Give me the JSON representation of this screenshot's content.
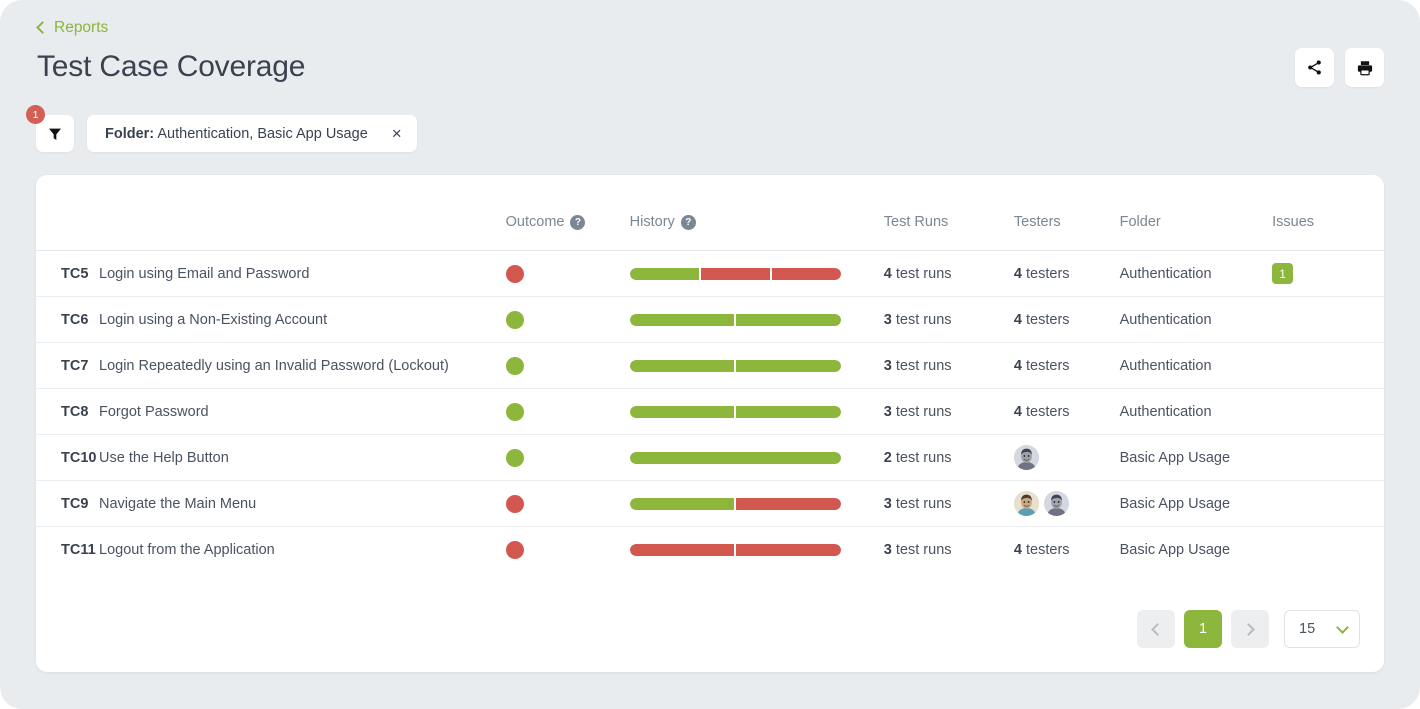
{
  "header": {
    "breadcrumb_label": "Reports",
    "title": "Test Case Coverage",
    "share_icon": "share-icon",
    "print_icon": "print-icon"
  },
  "filters": {
    "badge_count": "1",
    "filter_icon": "funnel-icon",
    "chip_prefix": "Folder:",
    "chip_value": " Authentication, Basic App Usage",
    "chip_close": "×"
  },
  "table": {
    "columns": [
      {
        "key": "id",
        "label": ""
      },
      {
        "key": "name",
        "label": ""
      },
      {
        "key": "outcome",
        "label": "Outcome",
        "help": true
      },
      {
        "key": "history",
        "label": "History",
        "help": true
      },
      {
        "key": "testruns",
        "label": "Test Runs"
      },
      {
        "key": "testers",
        "label": "Testers"
      },
      {
        "key": "folder",
        "label": "Folder"
      },
      {
        "key": "issues",
        "label": "Issues"
      }
    ],
    "rows": [
      {
        "id": "TC5",
        "name": "Login using Email and Password",
        "outcome": "fail",
        "history": [
          "pass",
          "fail",
          "fail"
        ],
        "test_runs_count": "4",
        "test_runs_label": " test runs",
        "testers_count": "4",
        "testers_label": " testers",
        "testers_avatars": 0,
        "folder": "Authentication",
        "issues": "1"
      },
      {
        "id": "TC6",
        "name": "Login using a Non-Existing Account",
        "outcome": "pass",
        "history": [
          "pass",
          "pass"
        ],
        "test_runs_count": "3",
        "test_runs_label": " test runs",
        "testers_count": "4",
        "testers_label": " testers",
        "testers_avatars": 0,
        "folder": "Authentication",
        "issues": ""
      },
      {
        "id": "TC7",
        "name": "Login Repeatedly using an Invalid Password (Lockout)",
        "outcome": "pass",
        "history": [
          "pass",
          "pass"
        ],
        "test_runs_count": "3",
        "test_runs_label": " test runs",
        "testers_count": "4",
        "testers_label": " testers",
        "testers_avatars": 0,
        "folder": "Authentication",
        "issues": ""
      },
      {
        "id": "TC8",
        "name": "Forgot Password",
        "outcome": "pass",
        "history": [
          "pass",
          "pass"
        ],
        "test_runs_count": "3",
        "test_runs_label": " test runs",
        "testers_count": "4",
        "testers_label": " testers",
        "testers_avatars": 0,
        "folder": "Authentication",
        "issues": ""
      },
      {
        "id": "TC10",
        "name": "Use the Help Button",
        "outcome": "pass",
        "history": [
          "pass"
        ],
        "test_runs_count": "2",
        "test_runs_label": " test runs",
        "testers_count": "",
        "testers_label": "",
        "testers_avatars": 1,
        "folder": "Basic App Usage",
        "issues": ""
      },
      {
        "id": "TC9",
        "name": "Navigate the Main Menu",
        "outcome": "fail",
        "history": [
          "pass",
          "fail"
        ],
        "test_runs_count": "3",
        "test_runs_label": " test runs",
        "testers_count": "",
        "testers_label": "",
        "testers_avatars": 2,
        "folder": "Basic App Usage",
        "issues": ""
      },
      {
        "id": "TC11",
        "name": "Logout from the Application",
        "outcome": "fail",
        "history": [
          "fail",
          "fail"
        ],
        "test_runs_count": "3",
        "test_runs_label": " test runs",
        "testers_count": "4",
        "testers_label": " testers",
        "testers_avatars": 0,
        "folder": "Basic App Usage",
        "issues": ""
      }
    ]
  },
  "pagination": {
    "prev_icon": "chevron-left-icon",
    "next_icon": "chevron-right-icon",
    "current_page": "1",
    "page_size": "15",
    "page_size_caret": "chevron-down-icon"
  },
  "colors": {
    "accent_green": "#8cb63c",
    "fail_red": "#d2574e",
    "badge_red": "#d35f57",
    "text_dark": "#3a4250",
    "text_muted": "#7b8794",
    "page_bg": "#e9ecef"
  }
}
